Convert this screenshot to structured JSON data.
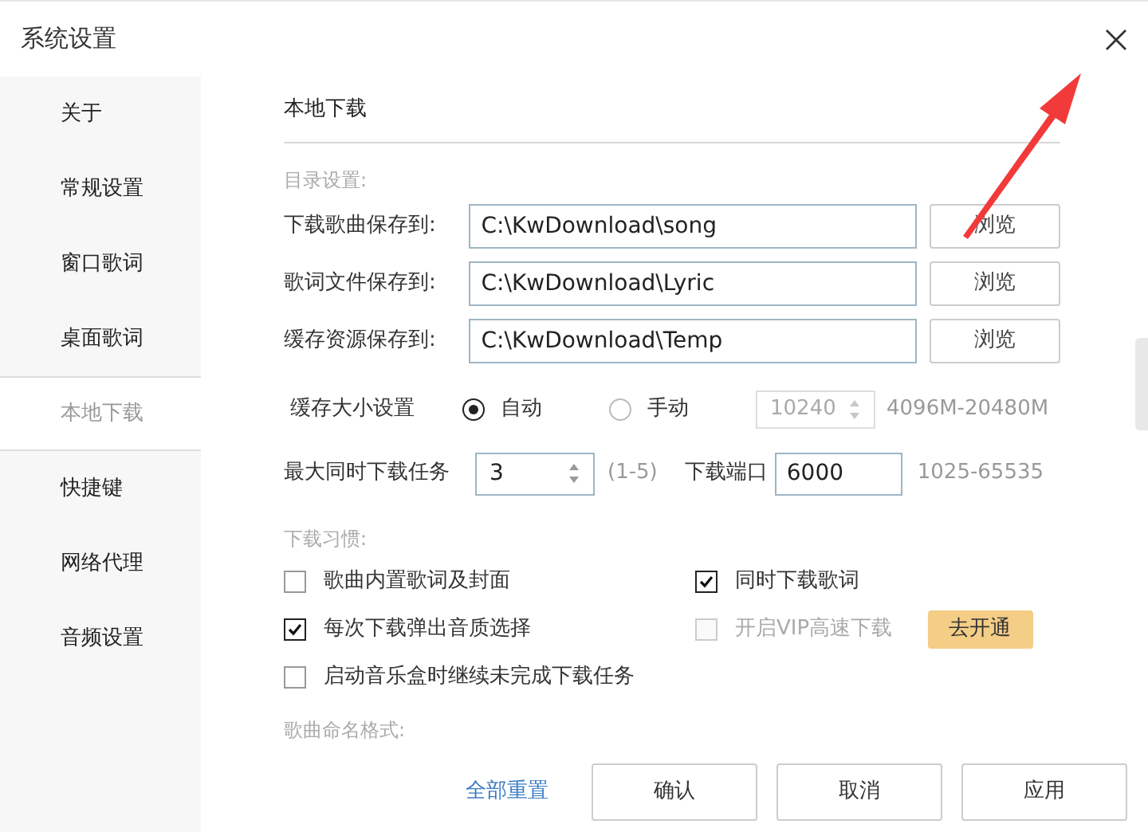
{
  "window": {
    "title": "系统设置"
  },
  "sidebar": {
    "items": [
      {
        "label": "关于",
        "selected": false
      },
      {
        "label": "常规设置",
        "selected": false
      },
      {
        "label": "窗口歌词",
        "selected": false
      },
      {
        "label": "桌面歌词",
        "selected": false
      },
      {
        "label": "本地下载",
        "selected": true
      },
      {
        "label": "快捷键",
        "selected": false
      },
      {
        "label": "网络代理",
        "selected": false
      },
      {
        "label": "音频设置",
        "selected": false
      }
    ]
  },
  "section": {
    "title": "本地下载"
  },
  "directory": {
    "label": "目录设置:",
    "rows": [
      {
        "label": "下载歌曲保存到:",
        "value": "C:\\KwDownload\\song",
        "button": "浏览"
      },
      {
        "label": "歌词文件保存到:",
        "value": "C:\\KwDownload\\Lyric",
        "button": "浏览"
      },
      {
        "label": "缓存资源保存到:",
        "value": "C:\\KwDownload\\Temp",
        "button": "浏览"
      }
    ]
  },
  "cache": {
    "label": "缓存大小设置",
    "options": [
      {
        "label": "自动",
        "selected": true
      },
      {
        "label": "手动",
        "selected": false
      }
    ],
    "size": {
      "value": "10240",
      "disabled": true
    },
    "range": "4096M-20480M"
  },
  "tasks": {
    "label": "最大同时下载任务",
    "value": "3",
    "range": "(1-5)"
  },
  "port": {
    "label": "下载端口",
    "value": "6000",
    "range": "1025-65535"
  },
  "habits": {
    "label": "下载习惯:",
    "options": [
      {
        "label": "歌曲内置歌词及封面",
        "checked": false,
        "disabled": false
      },
      {
        "label": "同时下载歌词",
        "checked": true,
        "disabled": false
      },
      {
        "label": "每次下载弹出音质选择",
        "checked": true,
        "disabled": false
      },
      {
        "label": "开启VIP高速下载",
        "checked": false,
        "disabled": true,
        "button": "去开通"
      },
      {
        "label": "启动音乐盒时继续未完成下载任务",
        "checked": false,
        "disabled": false
      }
    ]
  },
  "naming": {
    "label": "歌曲命名格式:"
  },
  "footer": {
    "reset": "全部重置",
    "buttons": [
      "确认",
      "取消",
      "应用"
    ]
  }
}
